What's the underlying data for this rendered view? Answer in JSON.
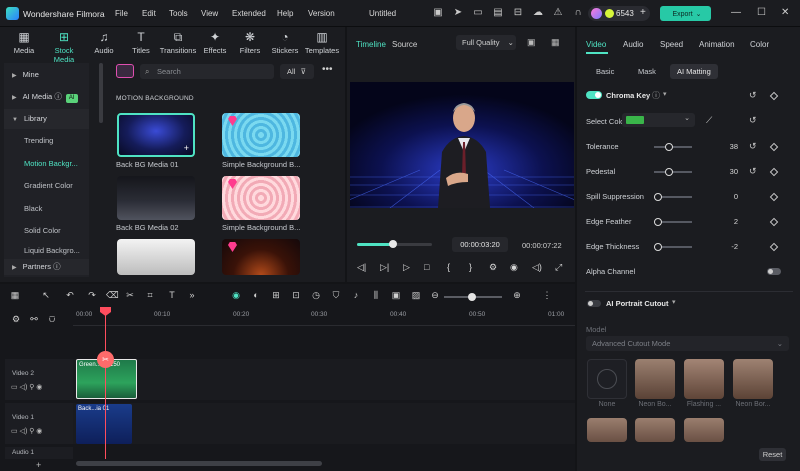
{
  "app": {
    "name": "Wondershare Filmora",
    "project_title": "Untitled",
    "credits": "6543",
    "export_label": "Export"
  },
  "menu": [
    "File",
    "Edit",
    "Tools",
    "View",
    "Extended",
    "Help",
    "Version"
  ],
  "media_tabs": [
    {
      "label": "Media",
      "icon": "media-icon"
    },
    {
      "label": "Stock Media",
      "icon": "stock-media-icon",
      "active": true
    },
    {
      "label": "Audio",
      "icon": "audio-icon"
    },
    {
      "label": "Titles",
      "icon": "titles-icon"
    },
    {
      "label": "Transitions",
      "icon": "transitions-icon"
    },
    {
      "label": "Effects",
      "icon": "effects-icon"
    },
    {
      "label": "Filters",
      "icon": "filters-icon"
    },
    {
      "label": "Stickers",
      "icon": "stickers-icon"
    },
    {
      "label": "Templates",
      "icon": "templates-icon"
    }
  ],
  "sidebar": {
    "mine": "Mine",
    "ai_media": "AI Media",
    "ai_badge": "AI",
    "library": "Library",
    "items": [
      "Trending",
      "Motion Backgr...",
      "Gradient Color",
      "Black",
      "Solid Color",
      "Liquid Backgro..."
    ],
    "partners": "Partners"
  },
  "search": {
    "placeholder": "Search",
    "filter_label": "All"
  },
  "section_title": "MOTION BACKGROUND",
  "thumbnails": [
    {
      "caption": "Back BG Media 01"
    },
    {
      "caption": "Simple Background B..."
    },
    {
      "caption": "Back BG Media 02"
    },
    {
      "caption": "Simple Background B..."
    },
    {
      "caption": ""
    },
    {
      "caption": ""
    }
  ],
  "player": {
    "tab_timeline": "Timeline",
    "tab_source": "Source",
    "quality": "Full Quality",
    "current_time": "00:00:03:20",
    "total_time": "00:00:07:22",
    "progress": 0.48
  },
  "props": {
    "tabs": [
      "Video",
      "Audio",
      "Speed",
      "Animation",
      "Color"
    ],
    "subtabs": [
      "Basic",
      "Mask",
      "AI Matting"
    ],
    "chroma_key": "Chroma Key",
    "select_color": "Select Color",
    "key_color": "#3ab54a",
    "rows": [
      {
        "label": "Tolerance",
        "value": "38",
        "level": 0.3
      },
      {
        "label": "Pedestal",
        "value": "30",
        "level": 0.3
      },
      {
        "label": "Spill Suppression",
        "value": "0",
        "level": 0
      },
      {
        "label": "Edge Feather",
        "value": "2",
        "level": 0
      },
      {
        "label": "Edge Thickness",
        "value": "-2",
        "level": 0
      }
    ],
    "alpha_channel": "Alpha Channel",
    "ai_portrait": "AI Portrait Cutout",
    "model_label": "Model",
    "model_value": "Advanced Cutout Mode",
    "presets": [
      "None",
      "Neon Bo...",
      "Flashing ...",
      "Neon Bor..."
    ],
    "reset": "Reset"
  },
  "timeline": {
    "ticks": [
      "00:00",
      "00:10",
      "00:20",
      "00:30",
      "00:40",
      "00:50",
      "01:00"
    ],
    "tracks": [
      {
        "label": "Video 2",
        "clip": "Green...MC150"
      },
      {
        "label": "Video 1",
        "clip": "Back...ia 01"
      },
      {
        "label": "Audio 1"
      }
    ]
  },
  "colors": {
    "accent": "#4fe3c3",
    "playhead": "#ff4d5e",
    "export": "#27c9a6"
  }
}
